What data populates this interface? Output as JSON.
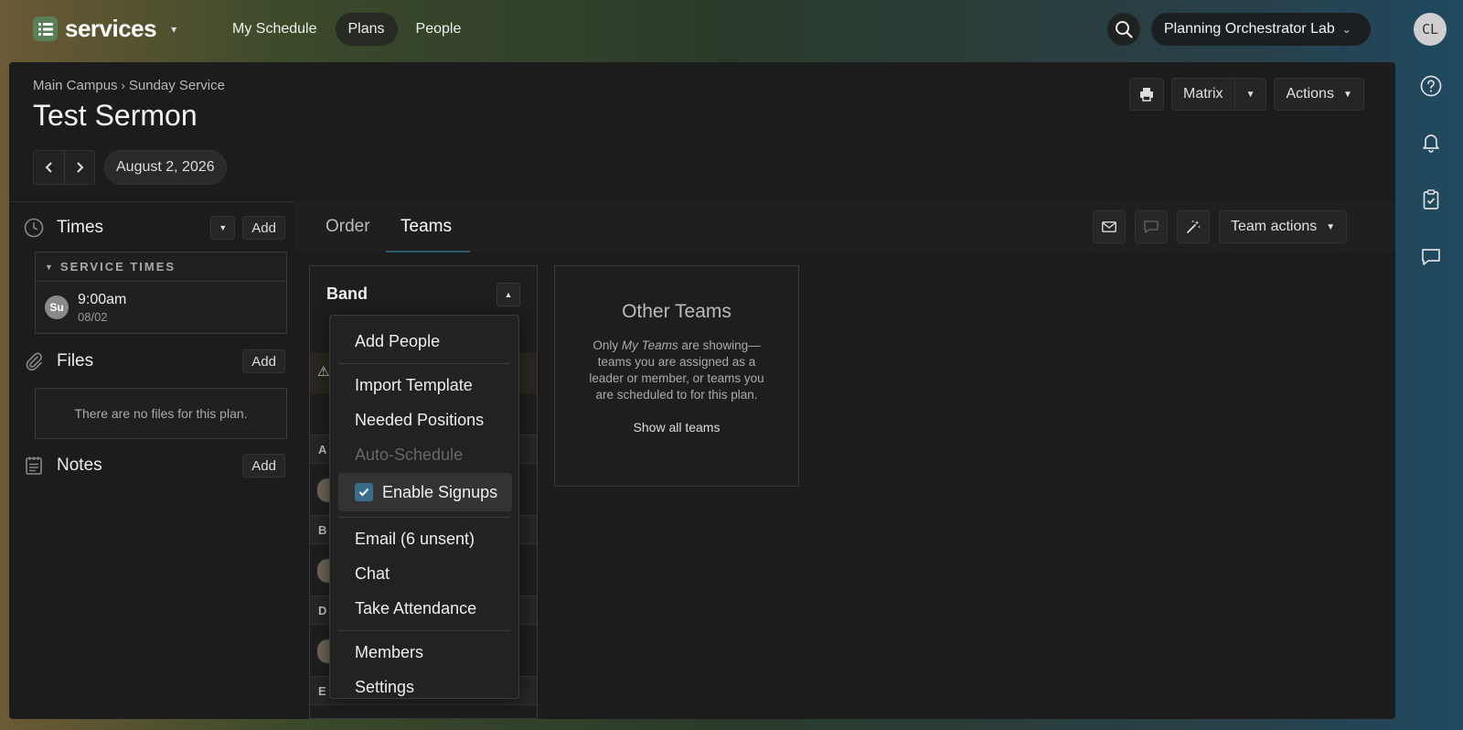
{
  "app": {
    "brand": "services"
  },
  "nav": {
    "items": [
      "My Schedule",
      "Plans",
      "People"
    ]
  },
  "org": {
    "name": "Planning Orchestrator Lab"
  },
  "user": {
    "initials": "CL"
  },
  "plan": {
    "breadcrumb": [
      "Main Campus",
      "Sunday Service"
    ],
    "title": "Test Sermon",
    "date": "August 2, 2026"
  },
  "header_buttons": {
    "matrix": "Matrix",
    "actions": "Actions"
  },
  "sidebar": {
    "times_label": "Times",
    "add_label": "Add",
    "service_times_header": "SERVICE TIMES",
    "service_time": {
      "day_badge": "Su",
      "time": "9:00am",
      "date": "08/02"
    },
    "files_label": "Files",
    "files_empty": "There are no files for this plan.",
    "notes_label": "Notes"
  },
  "tabs": [
    "Order",
    "Teams"
  ],
  "team_actions": "Team actions",
  "band": {
    "title": "Band",
    "letters": [
      "A",
      "B",
      "D",
      "E"
    ]
  },
  "other_teams": {
    "title": "Other Teams",
    "text_pre": "Only ",
    "text_em": "My Teams",
    "text_post": " are showing—teams you are assigned as a leader or member, or teams you are scheduled to for this plan.",
    "link": "Show all teams"
  },
  "dropdown": {
    "add_people": "Add People",
    "import_template": "Import Template",
    "needed_positions": "Needed Positions",
    "auto_schedule": "Auto-Schedule",
    "enable_signups": "Enable Signups",
    "email": "Email (6 unsent)",
    "chat": "Chat",
    "take_attendance": "Take Attendance",
    "members": "Members",
    "settings": "Settings"
  },
  "colors": {
    "accent": "#3a6d8a",
    "brand_green": "#5b7f58"
  }
}
